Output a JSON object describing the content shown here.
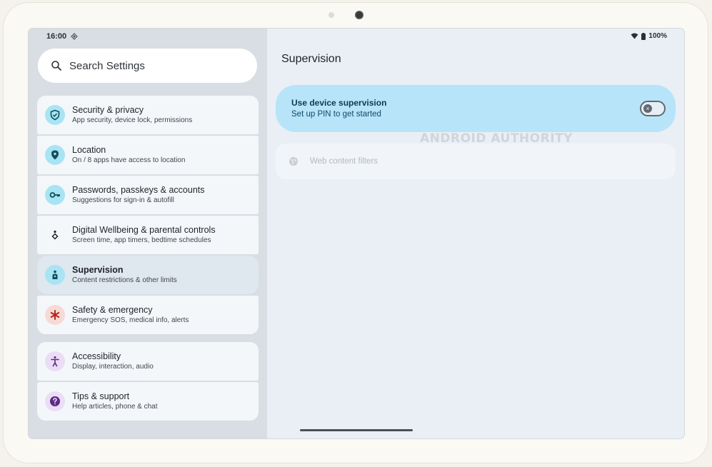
{
  "status": {
    "time": "16:00",
    "battery": "100%"
  },
  "search": {
    "placeholder": "Search Settings"
  },
  "groups": [
    {
      "items": [
        {
          "title": "Security & privacy",
          "subtitle": "App security, device lock, permissions",
          "icon": "shield-icon",
          "icon_bg": "#a8e4f3",
          "icon_color": "#114d5c"
        },
        {
          "title": "Location",
          "subtitle": "On / 8 apps have access to location",
          "icon": "location-pin-icon",
          "icon_bg": "#a8e4f3",
          "icon_color": "#114d5c"
        },
        {
          "title": "Passwords, passkeys & accounts",
          "subtitle": "Suggestions for sign-in & autofill",
          "icon": "key-icon",
          "icon_bg": "#a8e4f3",
          "icon_color": "#114d5c"
        },
        {
          "title": "Digital Wellbeing & parental controls",
          "subtitle": "Screen time, app timers, bedtime schedules",
          "icon": "wellbeing-icon",
          "icon_bg": "transparent",
          "icon_color": "#1f2328"
        },
        {
          "title": "Supervision",
          "subtitle": "Content restrictions & other limits",
          "icon": "supervision-icon",
          "icon_bg": "#a8e4f3",
          "icon_color": "#114d5c",
          "selected": true
        },
        {
          "title": "Safety & emergency",
          "subtitle": "Emergency SOS, medical info, alerts",
          "icon": "asterisk-icon",
          "icon_bg": "#f7d9d6",
          "icon_color": "#b3261e"
        }
      ]
    },
    {
      "items": [
        {
          "title": "Accessibility",
          "subtitle": "Display, interaction, audio",
          "icon": "accessibility-icon",
          "icon_bg": "#ecdcf5",
          "icon_color": "#5b2a86"
        },
        {
          "title": "Tips & support",
          "subtitle": "Help articles, phone & chat",
          "icon": "help-icon",
          "icon_bg": "#ecdcf5",
          "icon_color": "#5b2a86"
        }
      ]
    }
  ],
  "detail": {
    "title": "Supervision",
    "toggle_title": "Use device supervision",
    "toggle_subtitle": "Set up PIN to get started",
    "toggle_on": false,
    "filter_label": "Web content filters",
    "watermark": "ANDROID AUTHORITY"
  }
}
